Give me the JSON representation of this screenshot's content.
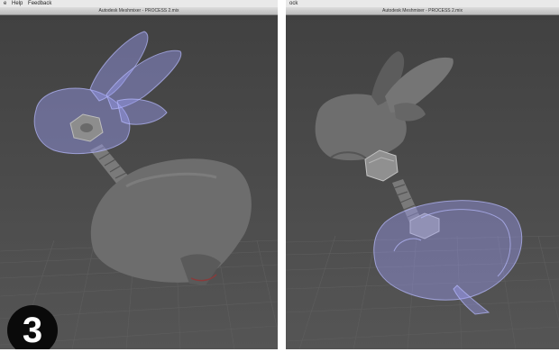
{
  "left_window": {
    "menu": [
      "e",
      "Help",
      "Feedback"
    ],
    "title": "Autodesk Meshmixer - PROCESS 2.mix"
  },
  "right_window": {
    "menu": [
      "ock"
    ],
    "title": "Autodesk Meshmixer - PROCESS 2.mix"
  },
  "step_badge": "3",
  "icons": [
    "rabbit-head-model",
    "hex-nut",
    "threaded-bolt",
    "rabbit-body-model"
  ],
  "colors": {
    "viewport_bg": "#4a4a4a",
    "ghost_mesh": "#9a9cf0",
    "solid_mesh": "#6e6e6e"
  }
}
